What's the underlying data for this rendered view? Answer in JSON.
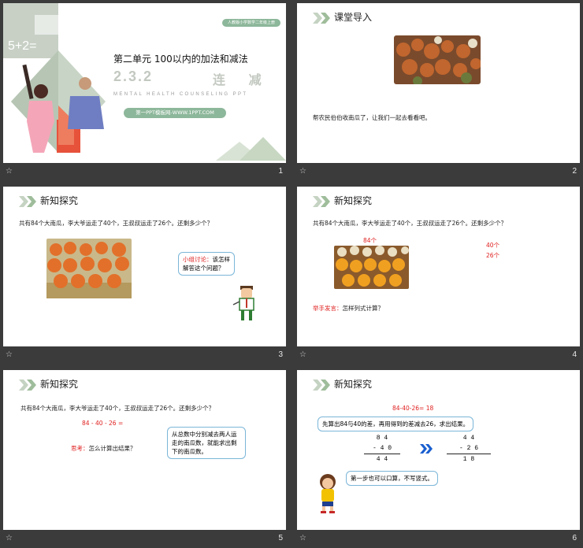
{
  "slides": [
    {
      "number": "1",
      "badge": "人教版小学数学二年级上册",
      "formula": "5+2=",
      "title": "第二单元  100以内的加法和减法",
      "lesson_number": "2.3.2",
      "lesson_name": "连 减",
      "subtitle_en": "MENTAL HEALTH COUNSELING PPT",
      "footer_pill": "第一PPT模板网-WWW.1PPT.COM"
    },
    {
      "number": "2",
      "title": "课堂导入",
      "body": "帮农民伯伯收南瓜了，让我们一起去看看吧。"
    },
    {
      "number": "3",
      "title": "新知探究",
      "question": "共有84个大南瓜，李大爷运走了40个，王叔叔运走了26个。还剩多少个？",
      "bubble_red": "小组讨论：",
      "bubble_rest": "该怎样解答这个问题？"
    },
    {
      "number": "4",
      "title": "新知探究",
      "question": "共有84个大南瓜，李大爷运走了40个，王叔叔运走了26个。还剩多少个？",
      "label_total": "84个",
      "label_a": "40个",
      "label_b": "26个",
      "prompt_red": "举手发言：",
      "prompt_rest": "怎样列式计算？"
    },
    {
      "number": "5",
      "title": "新知探究",
      "question": "共有84个大南瓜，李大爷运走了40个，王叔叔运走了26个。还剩多少个？",
      "equation": "84 - 40 - 26 =",
      "think_red": "思考：",
      "think_rest": "怎么计算出结果？",
      "bubble": "从总数中分别减去两人运走的南瓜数，就能求出剩下的南瓜数。"
    },
    {
      "number": "6",
      "title": "新知探究",
      "equation": "84-40-26= 18",
      "box1": "先算出84与40的差，再用得到的差减去26，求出结果。",
      "v1": {
        "top": "8 4",
        "sub": "- 4 0",
        "res": "4 4"
      },
      "v2": {
        "top": "4 4",
        "sub": "- 2 6",
        "res": "1 8"
      },
      "box2": "第一步也可以口算，不写竖式。"
    }
  ],
  "footer_icon": "☆",
  "colors": {
    "green": "#8db79a",
    "gray_green": "#c9d3c7",
    "red": "#e02020",
    "blue_border": "#7bb6d8"
  }
}
